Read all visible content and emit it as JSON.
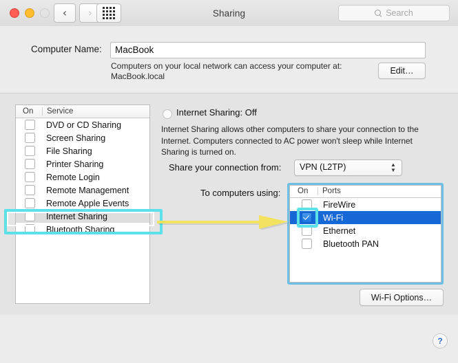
{
  "window": {
    "title": "Sharing",
    "traffic_lights": [
      "close-red",
      "minimize-yellow",
      "zoom-disabled"
    ],
    "nav": {
      "back": "‹",
      "forward": "›",
      "grid_icon": "show-all-grid"
    },
    "search": {
      "placeholder": "Search",
      "value": ""
    }
  },
  "header": {
    "computer_name_label": "Computer Name:",
    "computer_name_value": "MacBook",
    "note_line1": "Computers on your local network can access your computer at:",
    "note_line2": "MacBook.local",
    "edit_button": "Edit…"
  },
  "services": {
    "columns": {
      "on": "On",
      "service": "Service"
    },
    "items": [
      {
        "label": "DVD or CD Sharing",
        "checked": false,
        "selected": false
      },
      {
        "label": "Screen Sharing",
        "checked": false,
        "selected": false
      },
      {
        "label": "File Sharing",
        "checked": false,
        "selected": false
      },
      {
        "label": "Printer Sharing",
        "checked": false,
        "selected": false
      },
      {
        "label": "Remote Login",
        "checked": false,
        "selected": false
      },
      {
        "label": "Remote Management",
        "checked": false,
        "selected": false
      },
      {
        "label": "Remote Apple Events",
        "checked": false,
        "selected": false
      },
      {
        "label": "Internet Sharing",
        "checked": false,
        "selected": true
      },
      {
        "label": "Bluetooth Sharing",
        "checked": false,
        "selected": false
      }
    ]
  },
  "detail": {
    "status_title": "Internet Sharing: Off",
    "status_indicator": "off",
    "description": "Internet Sharing allows other computers to share your connection to the Internet. Computers connected to AC power won't sleep while Internet Sharing is turned on.",
    "share_from_label": "Share your connection from:",
    "share_from_value": "VPN (L2TP)",
    "to_computers_label": "To computers using:",
    "ports_columns": {
      "on": "On",
      "ports": "Ports"
    },
    "ports": [
      {
        "label": "FireWire",
        "checked": false,
        "selected": false
      },
      {
        "label": "Wi-Fi",
        "checked": true,
        "selected": true
      },
      {
        "label": "Ethernet",
        "checked": false,
        "selected": false
      },
      {
        "label": "Bluetooth PAN",
        "checked": false,
        "selected": false
      }
    ],
    "options_button": "Wi-Fi Options…"
  },
  "help_button": "?",
  "annotations": {
    "highlight_color": "#5ce1e8",
    "table_outline_color": "#6ebfe6",
    "arrow_color": "#f2e25f",
    "targets": [
      "internet-sharing-row",
      "wifi-checkbox",
      "ports-table"
    ]
  }
}
